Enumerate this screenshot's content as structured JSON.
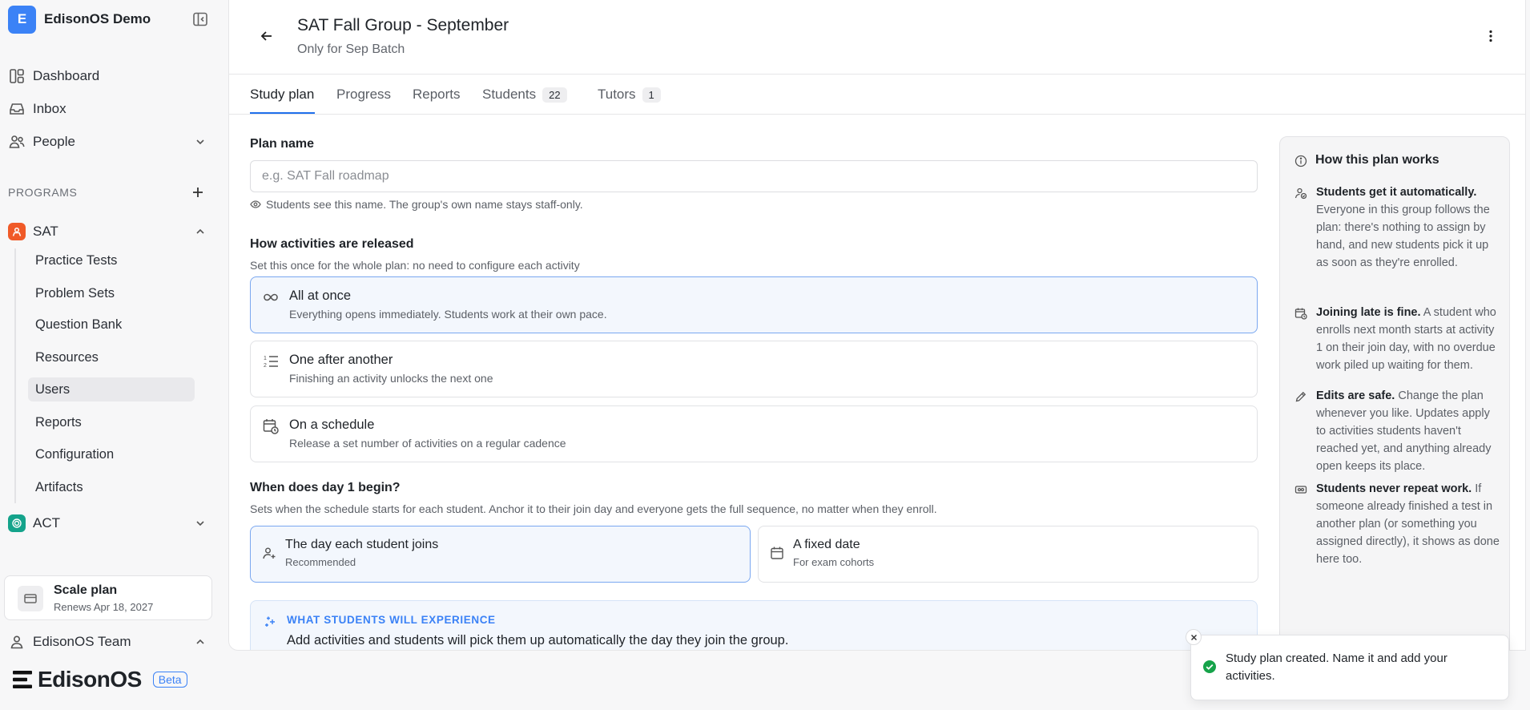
{
  "workspace": {
    "avatar": "E",
    "name": "EdisonOS Demo"
  },
  "nav": {
    "dashboard": "Dashboard",
    "inbox": "Inbox",
    "people": "People"
  },
  "programs": {
    "label": "PROGRAMS",
    "sat": {
      "name": "SAT",
      "items": [
        "Practice Tests",
        "Problem Sets",
        "Question Bank",
        "Resources",
        "Users",
        "Reports",
        "Configuration",
        "Artifacts"
      ],
      "active_item": "Users"
    },
    "act": {
      "name": "ACT"
    }
  },
  "plan": {
    "title": "Scale plan",
    "renews": "Renews Apr 18, 2027"
  },
  "team": {
    "name": "EdisonOS Team"
  },
  "brand": {
    "name": "EdisonOS",
    "badge": "Beta"
  },
  "header": {
    "title": "SAT Fall Group - September",
    "subtitle": "Only for Sep Batch"
  },
  "tabs": [
    {
      "label": "Study plan",
      "active": true
    },
    {
      "label": "Progress"
    },
    {
      "label": "Reports"
    },
    {
      "label": "Students",
      "count": "22"
    },
    {
      "label": "Tutors",
      "count": "1"
    }
  ],
  "form": {
    "plan_name_label": "Plan name",
    "plan_name_placeholder": "e.g. SAT Fall roadmap",
    "plan_name_value": "",
    "plan_name_hint": "Students see this name. The group's own name stays staff-only.",
    "release_label": "How activities are released",
    "release_help": "Set this once for the whole plan: no need to configure each activity",
    "release_options": [
      {
        "title": "All at once",
        "desc": "Everything opens immediately. Students work at their own pace.",
        "selected": true
      },
      {
        "title": "One after another",
        "desc": "Finishing an activity unlocks the next one"
      },
      {
        "title": "On a schedule",
        "desc": "Release a set number of activities on a regular cadence"
      }
    ],
    "day1_label": "When does day 1 begin?",
    "day1_help": "Sets when the schedule starts for each student. Anchor it to their join day and everyone gets the full sequence, no matter when they enroll.",
    "day1_options": [
      {
        "title": "The day each student joins",
        "desc": "Recommended",
        "selected": true
      },
      {
        "title": "A fixed date",
        "desc": "For exam cohorts"
      }
    ],
    "experience_label": "WHAT STUDENTS WILL EXPERIENCE",
    "experience_text": "Add activities and students will pick them up automatically the day they join the group."
  },
  "info": {
    "title": "How this plan works",
    "items": [
      {
        "bold": "Students get it automatically.",
        "text": " Everyone in this group follows the plan: there's nothing to assign by hand, and new students pick it up as soon as they're enrolled."
      },
      {
        "bold": "Joining late is fine.",
        "text": " A student who enrolls next month starts at activity 1 on their join day, with no overdue work piled up waiting for them."
      },
      {
        "bold": "Edits are safe.",
        "text": " Change the plan whenever you like. Updates apply to activities students haven't reached yet, and anything already open keeps its place."
      },
      {
        "bold": "Students never repeat work.",
        "text": " If someone already finished a test in another plan (or something you assigned directly), it shows as done here too."
      }
    ]
  },
  "toast": {
    "text": "Study plan created. Name it and add your activities."
  },
  "colors": {
    "accent": "#3b82f6",
    "sat": "#f05a28",
    "act": "#14a38b",
    "success": "#16a34a"
  }
}
